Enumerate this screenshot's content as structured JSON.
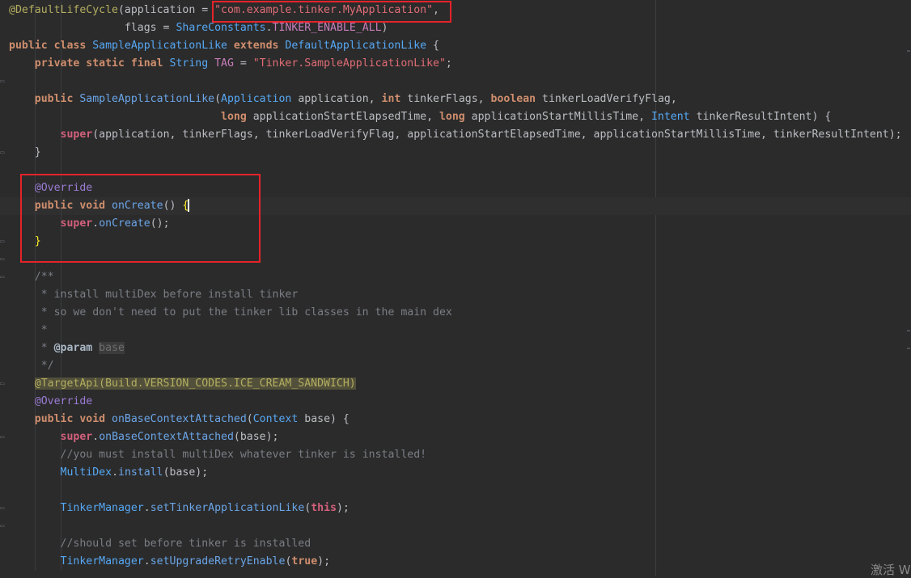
{
  "editor": {
    "lines": [
      {
        "segments": [
          [
            "ann",
            "@DefaultLifeCycle"
          ],
          [
            "id",
            "(application = "
          ],
          [
            "str",
            "\"com.example.tinker.MyApplication\""
          ],
          [
            "id",
            ","
          ]
        ]
      },
      {
        "segments": [
          [
            "id",
            "                  flags = "
          ],
          [
            "typ",
            "ShareConstants"
          ],
          [
            "id",
            "."
          ],
          [
            "cst",
            "TINKER_ENABLE_ALL"
          ],
          [
            "id",
            ")"
          ]
        ]
      },
      {
        "segments": [
          [
            "kw",
            "public class "
          ],
          [
            "typ",
            "SampleApplicationLike "
          ],
          [
            "kw",
            "extends "
          ],
          [
            "typ",
            "DefaultApplicationLike"
          ],
          [
            "id",
            " {"
          ]
        ]
      },
      {
        "segments": [
          [
            "id",
            "    "
          ],
          [
            "kw",
            "private static final "
          ],
          [
            "typ",
            "String "
          ],
          [
            "cst",
            "TAG"
          ],
          [
            "id",
            " = "
          ],
          [
            "str",
            "\"Tinker.SampleApplicationLike\""
          ],
          [
            "id",
            ";"
          ]
        ]
      },
      {
        "segments": [
          [
            "id",
            ""
          ]
        ]
      },
      {
        "segments": [
          [
            "id",
            "    "
          ],
          [
            "kw",
            "public "
          ],
          [
            "fn",
            "SampleApplicationLike"
          ],
          [
            "id",
            "("
          ],
          [
            "typ",
            "Application"
          ],
          [
            "id",
            " application, "
          ],
          [
            "kw",
            "int "
          ],
          [
            "id",
            "tinkerFlags, "
          ],
          [
            "kw",
            "boolean "
          ],
          [
            "id",
            "tinkerLoadVerifyFlag,"
          ]
        ]
      },
      {
        "segments": [
          [
            "id",
            "                                 "
          ],
          [
            "kw",
            "long "
          ],
          [
            "id",
            "applicationStartElapsedTime, "
          ],
          [
            "kw",
            "long "
          ],
          [
            "id",
            "applicationStartMillisTime, "
          ],
          [
            "typ",
            "Intent "
          ],
          [
            "id",
            "tinkerResultIntent) {"
          ]
        ]
      },
      {
        "segments": [
          [
            "id",
            "        "
          ],
          [
            "kw2",
            "super"
          ],
          [
            "id",
            "(application, tinkerFlags, tinkerLoadVerifyFlag, applicationStartElapsedTime, applicationStartMillisTime, tinkerResultIntent);"
          ]
        ]
      },
      {
        "segments": [
          [
            "id",
            "    }"
          ]
        ]
      },
      {
        "segments": [
          [
            "id",
            ""
          ]
        ]
      },
      {
        "segments": [
          [
            "id",
            "    "
          ],
          [
            "ann2",
            "@Override"
          ]
        ]
      },
      {
        "segments": [
          [
            "id",
            "    "
          ],
          [
            "kw",
            "public void "
          ],
          [
            "fn",
            "onCreate"
          ],
          [
            "id",
            "() "
          ],
          [
            "brace",
            "{"
          ]
        ],
        "caret": true
      },
      {
        "segments": [
          [
            "id",
            "        "
          ],
          [
            "kw2",
            "super"
          ],
          [
            "id",
            "."
          ],
          [
            "fn",
            "onCreate"
          ],
          [
            "id",
            "();"
          ]
        ]
      },
      {
        "segments": [
          [
            "id",
            "    "
          ],
          [
            "brace",
            "}"
          ]
        ]
      },
      {
        "segments": [
          [
            "id",
            ""
          ]
        ]
      },
      {
        "segments": [
          [
            "id",
            "    "
          ],
          [
            "cmt",
            "/**"
          ]
        ]
      },
      {
        "segments": [
          [
            "id",
            "     "
          ],
          [
            "cmt",
            "* install multiDex before install tinker"
          ]
        ]
      },
      {
        "segments": [
          [
            "id",
            "     "
          ],
          [
            "cmt",
            "* so we don't need to put the tinker lib classes in the main dex"
          ]
        ]
      },
      {
        "segments": [
          [
            "id",
            "     "
          ],
          [
            "cmt",
            "*"
          ]
        ]
      },
      {
        "segments": [
          [
            "id",
            "     "
          ],
          [
            "cmt",
            "* "
          ],
          [
            "tag",
            "@param "
          ],
          [
            "param",
            "base"
          ]
        ]
      },
      {
        "segments": [
          [
            "id",
            "     "
          ],
          [
            "cmt",
            "*/"
          ]
        ]
      },
      {
        "segments": [
          [
            "id",
            "    "
          ],
          [
            "annhl",
            "@TargetApi(Build.VERSION_CODES.ICE_CREAM_SANDWICH)"
          ]
        ]
      },
      {
        "segments": [
          [
            "id",
            "    "
          ],
          [
            "ann2",
            "@Override"
          ]
        ]
      },
      {
        "segments": [
          [
            "id",
            "    "
          ],
          [
            "kw",
            "public void "
          ],
          [
            "fn",
            "onBaseContextAttached"
          ],
          [
            "id",
            "("
          ],
          [
            "typ",
            "Context"
          ],
          [
            "id",
            " base) {"
          ]
        ]
      },
      {
        "segments": [
          [
            "id",
            "        "
          ],
          [
            "kw2",
            "super"
          ],
          [
            "id",
            "."
          ],
          [
            "fn",
            "onBaseContextAttached"
          ],
          [
            "id",
            "(base);"
          ]
        ]
      },
      {
        "segments": [
          [
            "id",
            "        "
          ],
          [
            "cmt",
            "//you must install multiDex whatever tinker is installed!"
          ]
        ]
      },
      {
        "segments": [
          [
            "id",
            "        "
          ],
          [
            "typ",
            "MultiDex"
          ],
          [
            "id",
            "."
          ],
          [
            "fn",
            "install"
          ],
          [
            "id",
            "(base);"
          ]
        ]
      },
      {
        "segments": [
          [
            "id",
            ""
          ]
        ]
      },
      {
        "segments": [
          [
            "id",
            "        "
          ],
          [
            "typ",
            "TinkerManager"
          ],
          [
            "id",
            "."
          ],
          [
            "fn",
            "setTinkerApplicationLike"
          ],
          [
            "id",
            "("
          ],
          [
            "kw2",
            "this"
          ],
          [
            "id",
            ");"
          ]
        ]
      },
      {
        "segments": [
          [
            "id",
            ""
          ]
        ]
      },
      {
        "segments": [
          [
            "id",
            "        "
          ],
          [
            "cmt",
            "//should set before tinker is installed"
          ]
        ]
      },
      {
        "segments": [
          [
            "id",
            "        "
          ],
          [
            "typ",
            "TinkerManager"
          ],
          [
            "id",
            "."
          ],
          [
            "fn",
            "setUpgradeRetryEnable"
          ],
          [
            "id",
            "("
          ],
          [
            "kw",
            "true"
          ],
          [
            "id",
            ");"
          ]
        ]
      }
    ],
    "gutter_marks": [
      4,
      8,
      13,
      14,
      15,
      21,
      24,
      28,
      29
    ]
  },
  "watermark": "激活 W"
}
